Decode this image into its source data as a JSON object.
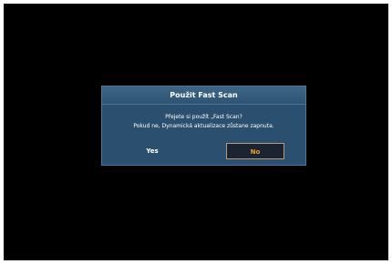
{
  "dialog": {
    "title": "Použit Fast Scan",
    "line1": "Přejete si použít „Fast Scan?",
    "line2": "Pokud ne, Dynamická aktualizace zůstane zapnuta.",
    "buttons": {
      "yes_label": "Yes",
      "no_label": "No"
    },
    "selected_button": "No"
  },
  "colors": {
    "screen_background": "#000000",
    "dialog_background": "#2b4f6e",
    "selected_text": "#f0a030",
    "selected_border": "#b79b76"
  }
}
